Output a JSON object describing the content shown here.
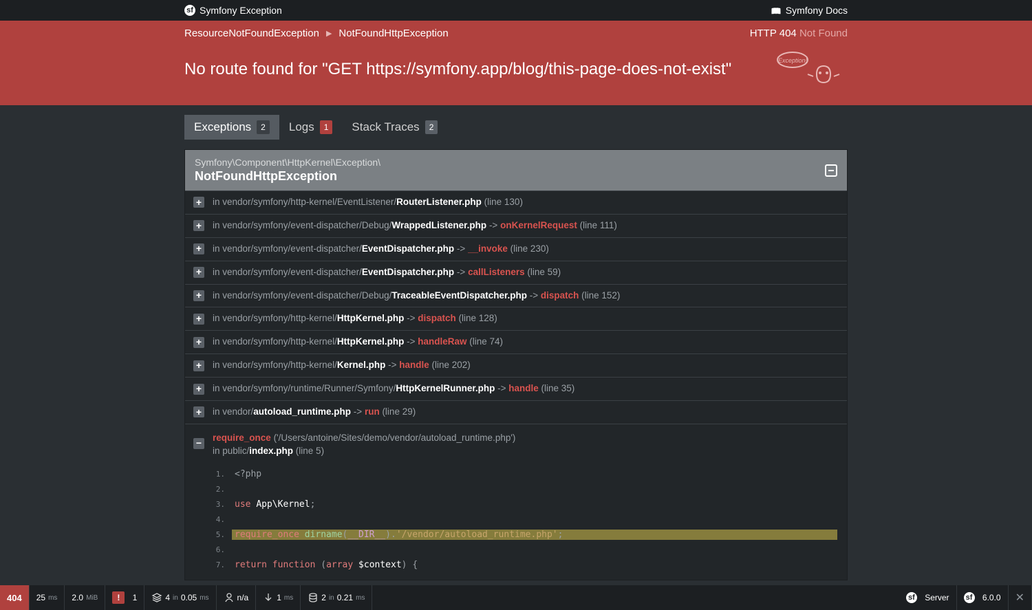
{
  "topbar": {
    "title": "Symfony Exception",
    "docs": "Symfony Docs"
  },
  "breadcrumb": {
    "items": [
      "ResourceNotFoundException",
      "NotFoundHttpException"
    ]
  },
  "http": {
    "code": "HTTP 404",
    "text": "Not Found"
  },
  "message": "No route found for \"GET https://symfony.app/blog/this-page-does-not-exist\"",
  "tabs": {
    "exceptions": {
      "label": "Exceptions",
      "count": "2"
    },
    "logs": {
      "label": "Logs",
      "count": "1"
    },
    "stack": {
      "label": "Stack Traces",
      "count": "2"
    }
  },
  "panel": {
    "namespace": "Symfony\\Component\\HttpKernel\\Exception\\",
    "class": "NotFoundHttpException"
  },
  "traces": [
    {
      "in": "in ",
      "p1": "vendor/symfony/http-kernel/EventListener/",
      "file": "RouterListener.php",
      "fn": "",
      "line": " (line 130)"
    },
    {
      "in": "in ",
      "p1": "vendor/symfony/event-dispatcher/Debug/",
      "file": "WrappedListener.php",
      "arrow": " -> ",
      "fn": "onKernelRequest",
      "line": " (line 111)"
    },
    {
      "in": "in ",
      "p1": "vendor/symfony/event-dispatcher/",
      "file": "EventDispatcher.php",
      "arrow": " -> ",
      "fn": "__invoke",
      "line": " (line 230)"
    },
    {
      "in": "in ",
      "p1": "vendor/symfony/event-dispatcher/",
      "file": "EventDispatcher.php",
      "arrow": " -> ",
      "fn": "callListeners",
      "line": " (line 59)"
    },
    {
      "in": "in ",
      "p1": "vendor/symfony/event-dispatcher/Debug/",
      "file": "TraceableEventDispatcher.php",
      "arrow": " -> ",
      "fn": "dispatch",
      "line": " (line 152)"
    },
    {
      "in": "in ",
      "p1": "vendor/symfony/http-kernel/",
      "file": "HttpKernel.php",
      "arrow": " -> ",
      "fn": "dispatch",
      "line": " (line 128)"
    },
    {
      "in": "in ",
      "p1": "vendor/symfony/http-kernel/",
      "file": "HttpKernel.php",
      "arrow": " -> ",
      "fn": "handleRaw",
      "line": " (line 74)"
    },
    {
      "in": "in ",
      "p1": "vendor/symfony/http-kernel/",
      "file": "Kernel.php",
      "arrow": " -> ",
      "fn": "handle",
      "line": " (line 202)"
    },
    {
      "in": "in ",
      "p1": "vendor/symfony/runtime/Runner/Symfony/",
      "file": "HttpKernelRunner.php",
      "arrow": " -> ",
      "fn": "handle",
      "line": " (line 35)"
    },
    {
      "in": "in ",
      "p1": "vendor/",
      "file": "autoload_runtime.php",
      "arrow": " -> ",
      "fn": "run",
      "line": " (line 29)"
    }
  ],
  "expanded": {
    "fn": "require_once",
    "arg": "('/Users/antoine/Sites/demo/vendor/autoload_runtime.php')",
    "in": "in ",
    "p1": "public/",
    "file": "index.php",
    "line": " (line 5)"
  },
  "code": {
    "lines": [
      {
        "n": "1",
        "html": "<span class='punct'>&lt;?php</span>"
      },
      {
        "n": "2",
        "html": ""
      },
      {
        "n": "3",
        "html": "<span class='kw'>use</span> <span class='cls2'>App\\Kernel</span><span class='punct'>;</span>"
      },
      {
        "n": "4",
        "html": ""
      },
      {
        "n": "5",
        "hl": true,
        "html": "<span class='kw'>require_once</span> <span class='fn2'>dirname</span><span class='punct'>(</span><span class='const'>__DIR__</span><span class='punct'>).</span><span class='str'>'/vendor/autoload_runtime.php'</span><span class='punct'>;</span>"
      },
      {
        "n": "6",
        "html": ""
      },
      {
        "n": "7",
        "html": "<span class='kw'>return</span> <span class='kw'>function</span> <span class='punct'>(</span><span class='kw'>array</span> <span class='var'>$context</span><span class='punct'>) {</span>"
      }
    ]
  },
  "toolbar": {
    "status": "404",
    "time": "25",
    "time_unit": "ms",
    "mem": "2.0",
    "mem_unit": "MiB",
    "errs": "1",
    "layers": "4",
    "layers_t": "0.05",
    "layers_u": "ms",
    "user": "n/a",
    "ajax": "1",
    "ajax_u": "ms",
    "db": "2",
    "db_t": "0.21",
    "db_u": "ms",
    "server": "Server",
    "version": "6.0.0"
  }
}
